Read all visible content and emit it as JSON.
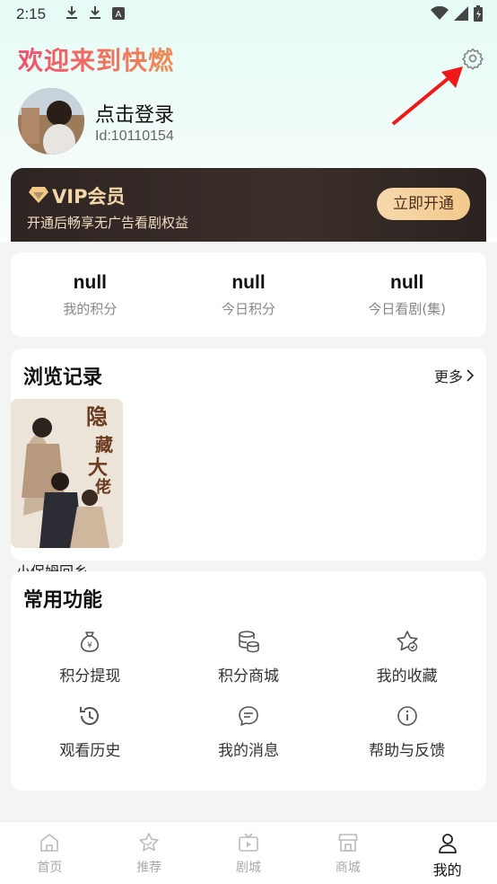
{
  "status_bar": {
    "time": "2:15",
    "icons": [
      "download-icon",
      "download-icon",
      "a-icon"
    ],
    "right_icons": [
      "wifi-icon",
      "signal-icon",
      "battery-icon"
    ]
  },
  "header": {
    "welcome": "欢迎来到快燃",
    "settings_icon": "gear-icon"
  },
  "user": {
    "login_label": "点击登录",
    "id_text": "Id:10110154"
  },
  "vip": {
    "title": "VIP会员",
    "subtitle": "开通后畅享无广告看剧权益",
    "button": "立即开通",
    "accent": "#f4d7a7"
  },
  "stats": [
    {
      "value": "null",
      "label": "我的积分"
    },
    {
      "value": "null",
      "label": "今日积分"
    },
    {
      "value": "null",
      "label": "今日看剧(集)"
    }
  ],
  "history": {
    "title": "浏览记录",
    "more": "更多",
    "items": [
      {
        "title": "小保姆回乡…",
        "poster_text": "隐藏大佬"
      }
    ]
  },
  "features": {
    "title": "常用功能",
    "items": [
      {
        "label": "积分提现",
        "icon": "money-bag-icon"
      },
      {
        "label": "积分商城",
        "icon": "coins-icon"
      },
      {
        "label": "我的收藏",
        "icon": "star-icon"
      },
      {
        "label": "观看历史",
        "icon": "history-icon"
      },
      {
        "label": "我的消息",
        "icon": "message-icon"
      },
      {
        "label": "帮助与反馈",
        "icon": "info-icon"
      }
    ]
  },
  "tabbar": [
    {
      "label": "首页",
      "icon": "home-icon",
      "active": false
    },
    {
      "label": "推荐",
      "icon": "recommend-icon",
      "active": false
    },
    {
      "label": "剧城",
      "icon": "tv-icon",
      "active": false
    },
    {
      "label": "商城",
      "icon": "store-icon",
      "active": false
    },
    {
      "label": "我的",
      "icon": "profile-icon",
      "active": true
    }
  ],
  "colors": {
    "brand_gradient_start": "#f0506c",
    "brand_gradient_end": "#ef8d55",
    "vip_bg": "#2e2422"
  }
}
